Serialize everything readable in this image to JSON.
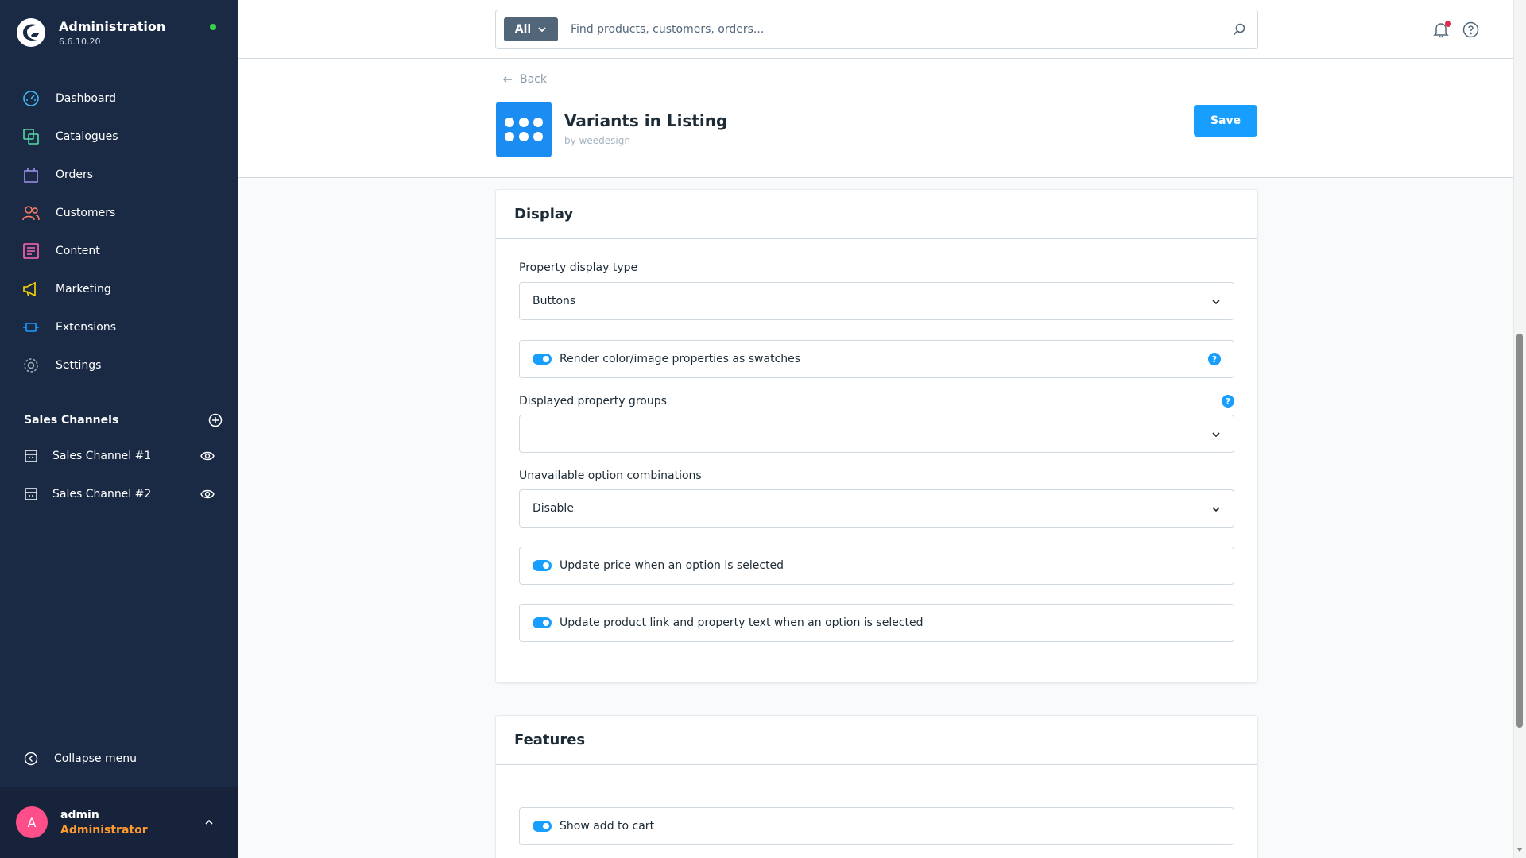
{
  "app": {
    "title": "Administration",
    "version": "6.6.10.20"
  },
  "nav": {
    "items": [
      {
        "label": "Dashboard",
        "icon": "dashboard-icon"
      },
      {
        "label": "Catalogues",
        "icon": "catalogues-icon"
      },
      {
        "label": "Orders",
        "icon": "orders-icon"
      },
      {
        "label": "Customers",
        "icon": "customers-icon"
      },
      {
        "label": "Content",
        "icon": "content-icon"
      },
      {
        "label": "Marketing",
        "icon": "marketing-icon"
      },
      {
        "label": "Extensions",
        "icon": "extensions-icon"
      },
      {
        "label": "Settings",
        "icon": "settings-icon"
      }
    ]
  },
  "sales_channels": {
    "heading": "Sales Channels",
    "items": [
      {
        "label": "Sales Channel #1"
      },
      {
        "label": "Sales Channel #2"
      }
    ]
  },
  "collapse_label": "Collapse menu",
  "user": {
    "initial": "A",
    "name": "admin",
    "role": "Administrator"
  },
  "search": {
    "type": "All",
    "placeholder": "Find products, customers, orders..."
  },
  "header": {
    "back_label": "Back",
    "title": "Variants in Listing",
    "byline": "by weedesign",
    "save_label": "Save"
  },
  "display": {
    "title": "Display",
    "property_display_type_label": "Property display type",
    "property_display_type_value": "Buttons",
    "swatches_label": "Render color/image properties as swatches",
    "displayed_groups_label": "Displayed property groups",
    "displayed_groups_value": "",
    "unavailable_label": "Unavailable option combinations",
    "unavailable_value": "Disable",
    "update_price_label": "Update price when an option is selected",
    "update_link_label": "Update product link and property text when an option is selected"
  },
  "features": {
    "title": "Features",
    "add_to_cart_label": "Show add to cart"
  },
  "colors": {
    "sidebar_bg": "#1b2a44",
    "accent": "#189eff",
    "role": "#ff9a2e",
    "avatar": "#ff4f8b"
  }
}
